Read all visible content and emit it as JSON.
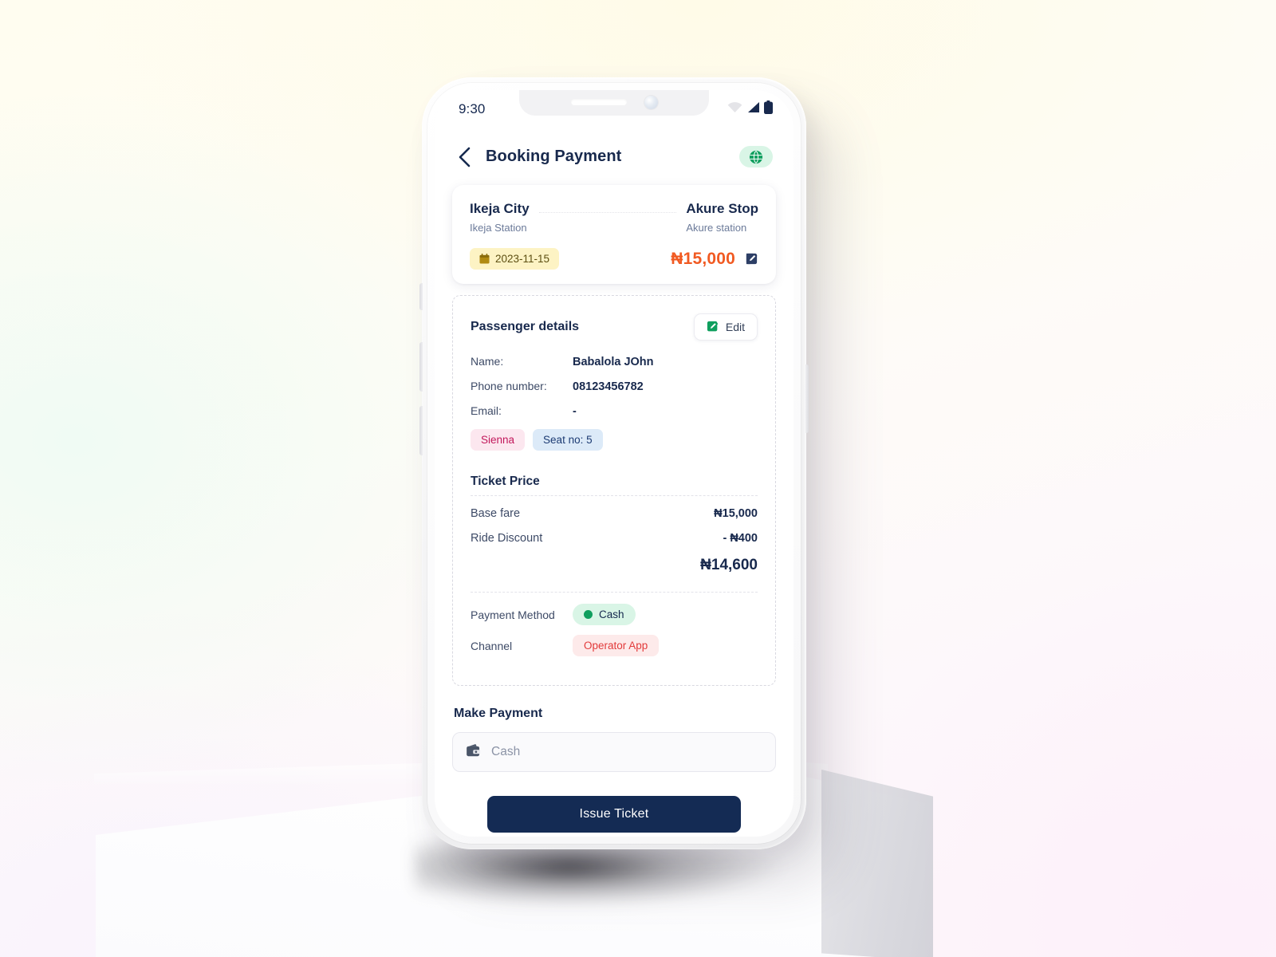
{
  "status_bar": {
    "time": "9:30",
    "wifi_icon": "wifi-icon",
    "signal_icon": "signal-icon",
    "battery_icon": "battery-icon"
  },
  "header": {
    "back_icon": "chevron-left-icon",
    "title": "Booking Payment",
    "globe_icon": "globe-icon"
  },
  "route": {
    "origin_city": "Ikeja City",
    "origin_station": "Ikeja Station",
    "destination_city": "Akure Stop",
    "destination_station": "Akure station",
    "date": "2023-11-15",
    "date_icon": "calendar-icon",
    "fare": "₦15,000",
    "fare_edit_icon": "edit-square-icon",
    "date_pill_bg": "#fdf3c4",
    "fare_color": "#f15a22"
  },
  "passenger": {
    "section_title": "Passenger details",
    "edit_label": "Edit",
    "edit_icon": "pencil-icon",
    "rows": [
      {
        "key": "Name:",
        "value": "Babalola JOhn"
      },
      {
        "key": "Phone number:",
        "value": "08123456782"
      },
      {
        "key": "Email:",
        "value": "-"
      }
    ],
    "vehicle_chip": "Sienna",
    "seat_chip": "Seat no: 5",
    "vehicle_chip_color": "#c2185b",
    "seat_chip_color": "#1c3b73"
  },
  "ticket_price": {
    "title": "Ticket Price",
    "rows": [
      {
        "label": "Base fare",
        "value": "₦15,000"
      },
      {
        "label": "Ride Discount",
        "value": "- ₦400"
      }
    ],
    "total": "₦14,600"
  },
  "payment_info": {
    "method_label": "Payment Method",
    "method_value": "Cash",
    "channel_label": "Channel",
    "channel_value": "Operator App",
    "method_badge_bg": "#d9f5e6",
    "method_dot_color": "#0f9f5e",
    "channel_badge_bg": "#fdeaea",
    "channel_text_color": "#e23b3b"
  },
  "make_payment": {
    "title": "Make Payment",
    "input_value": "Cash",
    "input_placeholder": "Cash",
    "wallet_icon": "wallet-icon"
  },
  "cta": {
    "label": "Issue Ticket",
    "bg": "#142b54"
  }
}
